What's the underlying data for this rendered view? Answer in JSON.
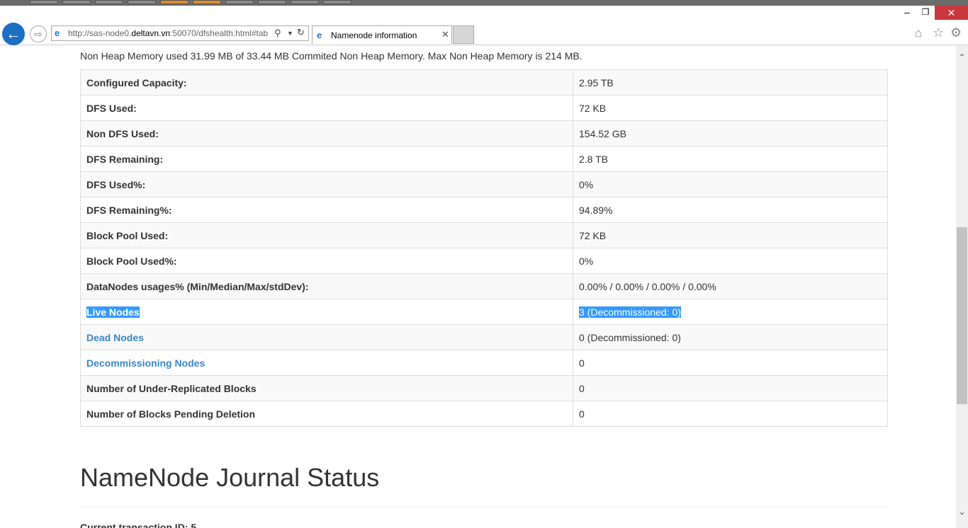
{
  "browser": {
    "url_prefix": "http://sas-node0.",
    "url_domain": "deltavn.vn",
    "url_suffix": ":50070/dfshealth.html#tab",
    "tab_title": "Namenode information"
  },
  "page": {
    "heap_text": "Non Heap Memory used 31.99 MB of 33.44 MB Commited Non Heap Memory. Max Non Heap Memory is 214 MB.",
    "rows": [
      {
        "label": "Configured Capacity:",
        "value": "2.95 TB"
      },
      {
        "label": "DFS Used:",
        "value": "72 KB"
      },
      {
        "label": "Non DFS Used:",
        "value": "154.52 GB"
      },
      {
        "label": "DFS Remaining:",
        "value": "2.8 TB"
      },
      {
        "label": "DFS Used%:",
        "value": "0%"
      },
      {
        "label": "DFS Remaining%:",
        "value": "94.89%"
      },
      {
        "label": "Block Pool Used:",
        "value": "72 KB"
      },
      {
        "label": "Block Pool Used%:",
        "value": "0%"
      },
      {
        "label": "DataNodes usages% (Min/Median/Max/stdDev):",
        "value": "0.00% / 0.00% / 0.00% / 0.00%"
      },
      {
        "label": "Live Nodes",
        "value": "3 (Decommissioned: 0)"
      },
      {
        "label": "Dead Nodes",
        "value": "0 (Decommissioned: 0)"
      },
      {
        "label": "Decommissioning Nodes",
        "value": "0"
      },
      {
        "label": "Number of Under-Replicated Blocks",
        "value": "0"
      },
      {
        "label": "Number of Blocks Pending Deletion",
        "value": "0"
      }
    ],
    "journal_title": "NameNode Journal Status",
    "current_txn": "Current transaction ID: 5"
  },
  "colors": {
    "link": "#3a87c8",
    "selection": "#3399ff",
    "close_button": "#c7383f"
  }
}
